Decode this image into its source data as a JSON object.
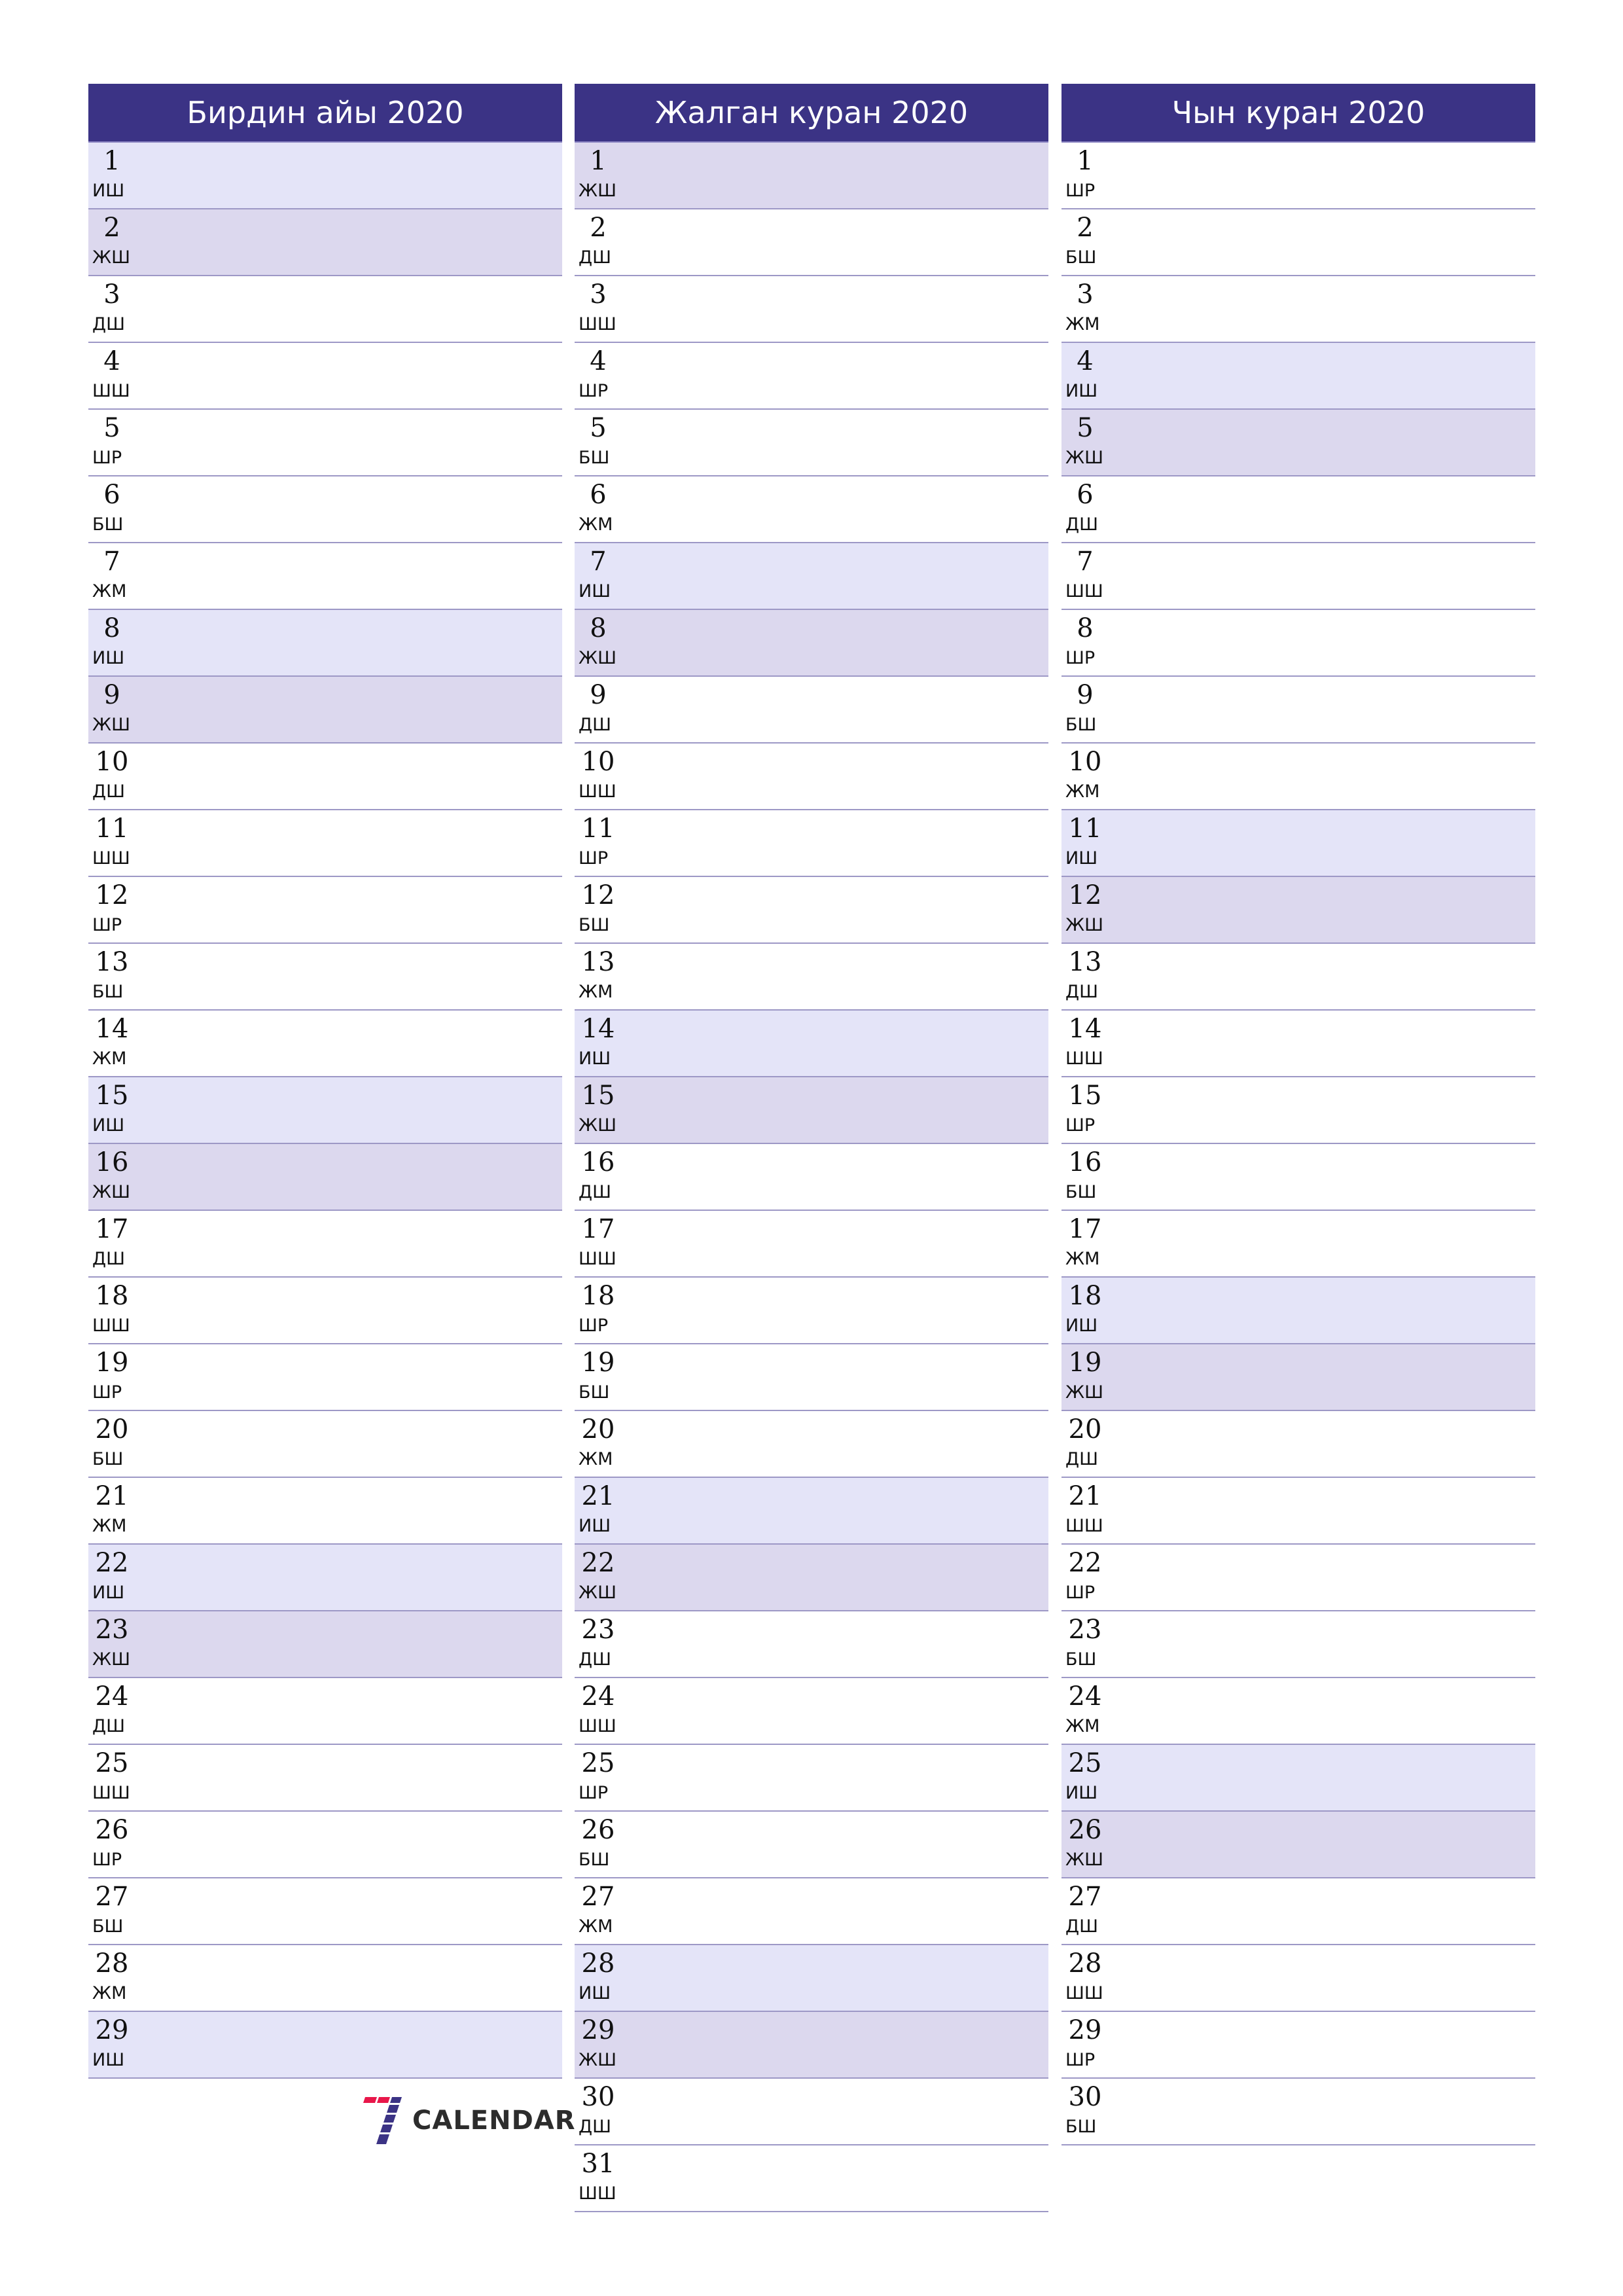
{
  "colors": {
    "header_bg": "#3b3385",
    "saturday_bg": "#e4e4f8",
    "sunday_bg": "#dcd8ee",
    "row_border": "#9d98c6",
    "logo_red": "#e8174a",
    "logo_blue": "#3b3385"
  },
  "weekday_cycle": [
    "ИШ",
    "ЖШ",
    "ДШ",
    "ШШ",
    "ШР",
    "БШ",
    "ЖМ"
  ],
  "months": [
    {
      "title": "Бирдин айы 2020",
      "days": [
        {
          "n": "1",
          "d": "ИШ"
        },
        {
          "n": "2",
          "d": "ЖШ"
        },
        {
          "n": "3",
          "d": "ДШ"
        },
        {
          "n": "4",
          "d": "ШШ"
        },
        {
          "n": "5",
          "d": "ШР"
        },
        {
          "n": "6",
          "d": "БШ"
        },
        {
          "n": "7",
          "d": "ЖМ"
        },
        {
          "n": "8",
          "d": "ИШ"
        },
        {
          "n": "9",
          "d": "ЖШ"
        },
        {
          "n": "10",
          "d": "ДШ"
        },
        {
          "n": "11",
          "d": "ШШ"
        },
        {
          "n": "12",
          "d": "ШР"
        },
        {
          "n": "13",
          "d": "БШ"
        },
        {
          "n": "14",
          "d": "ЖМ"
        },
        {
          "n": "15",
          "d": "ИШ"
        },
        {
          "n": "16",
          "d": "ЖШ"
        },
        {
          "n": "17",
          "d": "ДШ"
        },
        {
          "n": "18",
          "d": "ШШ"
        },
        {
          "n": "19",
          "d": "ШР"
        },
        {
          "n": "20",
          "d": "БШ"
        },
        {
          "n": "21",
          "d": "ЖМ"
        },
        {
          "n": "22",
          "d": "ИШ"
        },
        {
          "n": "23",
          "d": "ЖШ"
        },
        {
          "n": "24",
          "d": "ДШ"
        },
        {
          "n": "25",
          "d": "ШШ"
        },
        {
          "n": "26",
          "d": "ШР"
        },
        {
          "n": "27",
          "d": "БШ"
        },
        {
          "n": "28",
          "d": "ЖМ"
        },
        {
          "n": "29",
          "d": "ИШ"
        }
      ]
    },
    {
      "title": "Жалган куран 2020",
      "days": [
        {
          "n": "1",
          "d": "ЖШ"
        },
        {
          "n": "2",
          "d": "ДШ"
        },
        {
          "n": "3",
          "d": "ШШ"
        },
        {
          "n": "4",
          "d": "ШР"
        },
        {
          "n": "5",
          "d": "БШ"
        },
        {
          "n": "6",
          "d": "ЖМ"
        },
        {
          "n": "7",
          "d": "ИШ"
        },
        {
          "n": "8",
          "d": "ЖШ"
        },
        {
          "n": "9",
          "d": "ДШ"
        },
        {
          "n": "10",
          "d": "ШШ"
        },
        {
          "n": "11",
          "d": "ШР"
        },
        {
          "n": "12",
          "d": "БШ"
        },
        {
          "n": "13",
          "d": "ЖМ"
        },
        {
          "n": "14",
          "d": "ИШ"
        },
        {
          "n": "15",
          "d": "ЖШ"
        },
        {
          "n": "16",
          "d": "ДШ"
        },
        {
          "n": "17",
          "d": "ШШ"
        },
        {
          "n": "18",
          "d": "ШР"
        },
        {
          "n": "19",
          "d": "БШ"
        },
        {
          "n": "20",
          "d": "ЖМ"
        },
        {
          "n": "21",
          "d": "ИШ"
        },
        {
          "n": "22",
          "d": "ЖШ"
        },
        {
          "n": "23",
          "d": "ДШ"
        },
        {
          "n": "24",
          "d": "ШШ"
        },
        {
          "n": "25",
          "d": "ШР"
        },
        {
          "n": "26",
          "d": "БШ"
        },
        {
          "n": "27",
          "d": "ЖМ"
        },
        {
          "n": "28",
          "d": "ИШ"
        },
        {
          "n": "29",
          "d": "ЖШ"
        },
        {
          "n": "30",
          "d": "ДШ"
        },
        {
          "n": "31",
          "d": "ШШ"
        }
      ]
    },
    {
      "title": "Чын куран 2020",
      "days": [
        {
          "n": "1",
          "d": "ШР"
        },
        {
          "n": "2",
          "d": "БШ"
        },
        {
          "n": "3",
          "d": "ЖМ"
        },
        {
          "n": "4",
          "d": "ИШ"
        },
        {
          "n": "5",
          "d": "ЖШ"
        },
        {
          "n": "6",
          "d": "ДШ"
        },
        {
          "n": "7",
          "d": "ШШ"
        },
        {
          "n": "8",
          "d": "ШР"
        },
        {
          "n": "9",
          "d": "БШ"
        },
        {
          "n": "10",
          "d": "ЖМ"
        },
        {
          "n": "11",
          "d": "ИШ"
        },
        {
          "n": "12",
          "d": "ЖШ"
        },
        {
          "n": "13",
          "d": "ДШ"
        },
        {
          "n": "14",
          "d": "ШШ"
        },
        {
          "n": "15",
          "d": "ШР"
        },
        {
          "n": "16",
          "d": "БШ"
        },
        {
          "n": "17",
          "d": "ЖМ"
        },
        {
          "n": "18",
          "d": "ИШ"
        },
        {
          "n": "19",
          "d": "ЖШ"
        },
        {
          "n": "20",
          "d": "ДШ"
        },
        {
          "n": "21",
          "d": "ШШ"
        },
        {
          "n": "22",
          "d": "ШР"
        },
        {
          "n": "23",
          "d": "БШ"
        },
        {
          "n": "24",
          "d": "ЖМ"
        },
        {
          "n": "25",
          "d": "ИШ"
        },
        {
          "n": "26",
          "d": "ЖШ"
        },
        {
          "n": "27",
          "d": "ДШ"
        },
        {
          "n": "28",
          "d": "ШШ"
        },
        {
          "n": "29",
          "d": "ШР"
        },
        {
          "n": "30",
          "d": "БШ"
        }
      ]
    }
  ],
  "logo": {
    "mark": "7",
    "icon": "seven-calendar-logo-icon",
    "text": "CALENDAR"
  }
}
